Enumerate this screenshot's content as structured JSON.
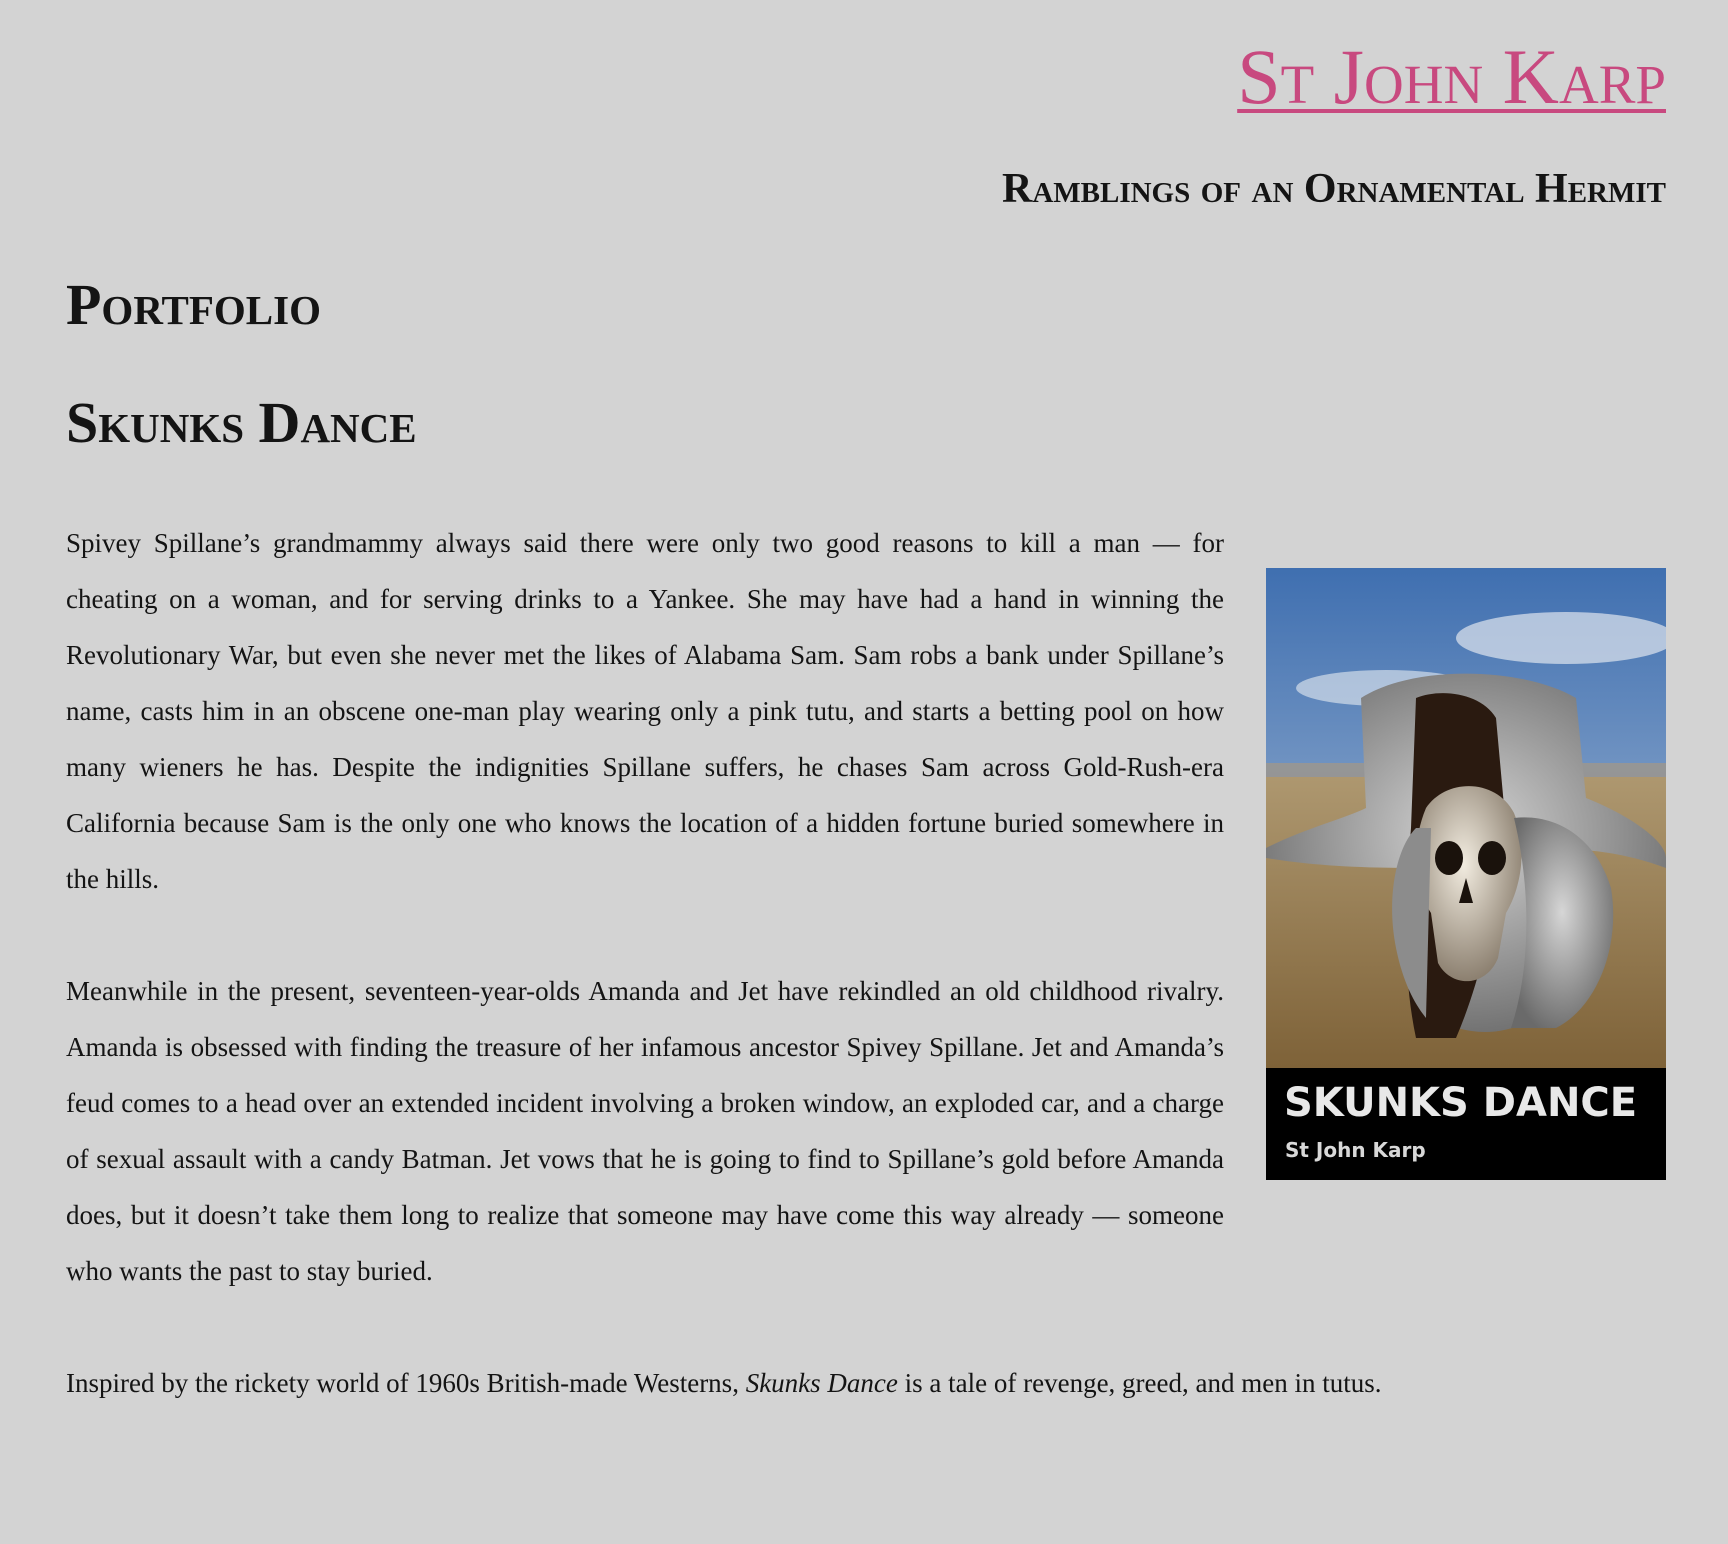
{
  "header": {
    "site_title": "St John Karp",
    "site_subtitle": "Ramblings of an Ornamental Hermit"
  },
  "page": {
    "section_title": "Portfolio",
    "post_title": "Skunks Dance"
  },
  "cover": {
    "title": "SKUNKS DANCE",
    "author": "St John Karp",
    "colors": {
      "sky_top": "#3f6fb0",
      "sky_bottom": "#b9c9dc",
      "desert": "#9c7e52",
      "band": "#000000"
    }
  },
  "paragraphs": {
    "p1": "Spivey Spillane’s grandmammy always said there were only two good reasons to kill a man — for cheating on a woman, and for serving drinks to a Yankee. She may have had a hand in winning the Revolutionary War, but even she never met the likes of Alabama Sam. Sam robs a bank under Spillane’s name, casts him in an obscene one-man play wearing only a pink tutu, and starts a betting pool on how many wieners he has. Despite the indignities Spillane suffers, he chases Sam across Gold-Rush-era California because Sam is the only one who knows the location of a hidden fortune buried somewhere in the hills.",
    "p2": "Meanwhile in the present, seventeen-year-olds Amanda and Jet have rekindled an old childhood rivalry. Amanda is obsessed with finding the treasure of her infamous ancestor Spivey Spillane. Jet and Amanda’s feud comes to a head over an extended incident involving a broken window, an exploded car, and a charge of sexual assault with a candy Batman. Jet vows that he is going to find to Spillane’s gold before Amanda does, but it doesn’t take them long to realize that someone may have come this way already — someone who wants the past to stay buried.",
    "p3_before": "Inspired by the rickety world of 1960s British-made Westerns, ",
    "p3_title": "Skunks Dance",
    "p3_after": " is a tale of revenge, greed, and men in tutus."
  }
}
